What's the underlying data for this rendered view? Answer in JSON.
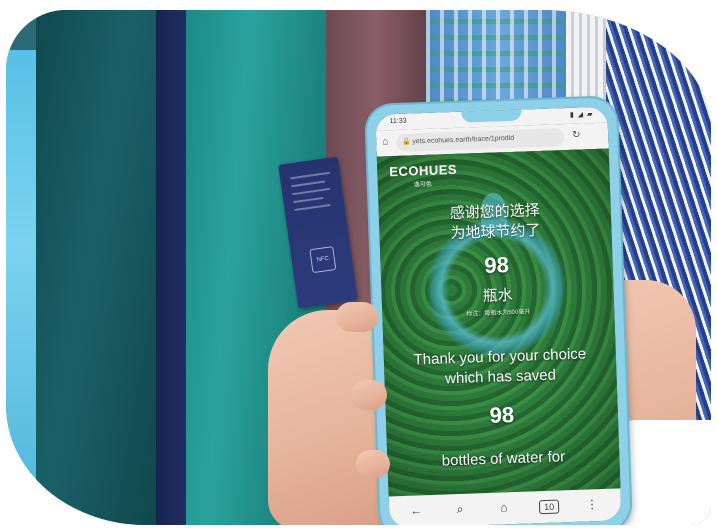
{
  "tag": {
    "nfc_label": "NFC"
  },
  "phone": {
    "status": {
      "time": "11:33",
      "icons": "▮ ◢ ▰"
    },
    "browser": {
      "url": "yets.ecohues.earth/trace/1prodid",
      "home_icon": "⌂",
      "lock_icon": "🔒",
      "reload_icon": "↻"
    },
    "page": {
      "brand": "ECOHUES",
      "brand_sub": "逸可色",
      "headline_cn_1": "感谢您的选择",
      "headline_cn_2": "为地球节约了",
      "count_1": "98",
      "unit_cn": "瓶水",
      "footnote_cn": "标注：每瓶水为500毫升",
      "headline_en_1": "Thank you for your choice",
      "headline_en_2": "which has saved",
      "count_2": "98",
      "headline_en_3": "bottles of water for"
    },
    "nav": {
      "back": "←",
      "search": "⌕",
      "home": "⌂",
      "tabs": "10",
      "menu": "⋮"
    }
  },
  "colors": {
    "phone_case": "#8ed0e8",
    "forest": "#2a7034",
    "tag": "#26336e"
  }
}
